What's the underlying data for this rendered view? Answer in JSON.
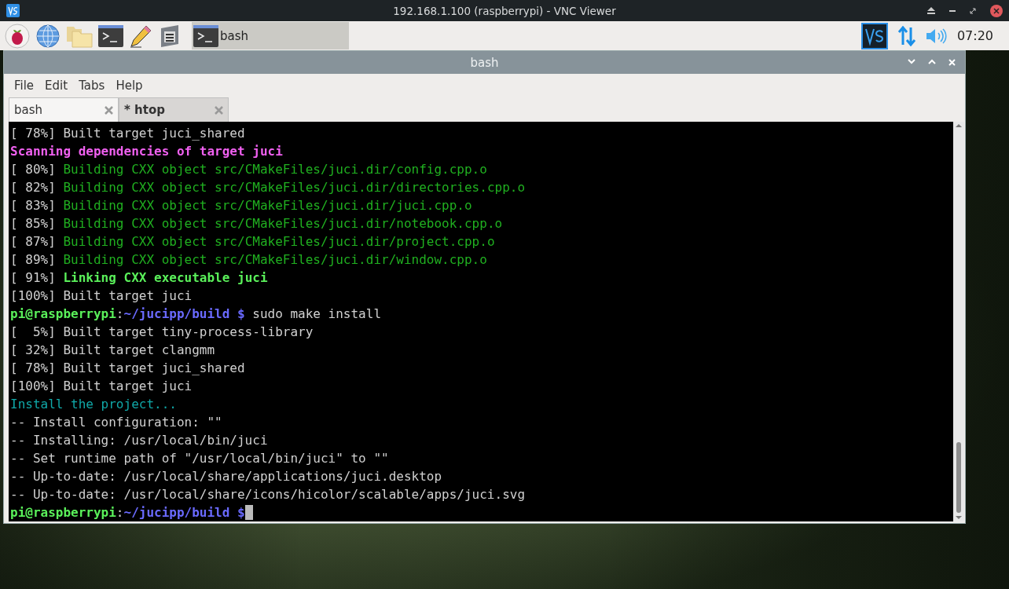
{
  "vnc_window": {
    "title": "192.168.1.100 (raspberrypi) - VNC Viewer"
  },
  "taskbar": {
    "task_button": {
      "label": "bash"
    },
    "clock": "07:20"
  },
  "terminal": {
    "title": "bash",
    "menu": [
      "File",
      "Edit",
      "Tabs",
      "Help"
    ],
    "tabs": [
      {
        "label": "bash",
        "selected": true,
        "activity": false
      },
      {
        "label": "* htop",
        "selected": false,
        "activity": true
      }
    ],
    "lines": [
      {
        "cursor": false,
        "segments": [
          {
            "text": "[ 78%] Built target juci_shared",
            "kind": "plain"
          }
        ]
      },
      {
        "cursor": false,
        "segments": [
          {
            "text": "Scanning dependencies of target juci",
            "kind": "scan"
          }
        ]
      },
      {
        "cursor": false,
        "segments": [
          {
            "text": "[ 80%] ",
            "kind": "plain"
          },
          {
            "text": "Building CXX object src/CMakeFiles/juci.dir/config.cpp.o",
            "kind": "build"
          }
        ]
      },
      {
        "cursor": false,
        "segments": [
          {
            "text": "[ 82%] ",
            "kind": "plain"
          },
          {
            "text": "Building CXX object src/CMakeFiles/juci.dir/directories.cpp.o",
            "kind": "build"
          }
        ]
      },
      {
        "cursor": false,
        "segments": [
          {
            "text": "[ 83%] ",
            "kind": "plain"
          },
          {
            "text": "Building CXX object src/CMakeFiles/juci.dir/juci.cpp.o",
            "kind": "build"
          }
        ]
      },
      {
        "cursor": false,
        "segments": [
          {
            "text": "[ 85%] ",
            "kind": "plain"
          },
          {
            "text": "Building CXX object src/CMakeFiles/juci.dir/notebook.cpp.o",
            "kind": "build"
          }
        ]
      },
      {
        "cursor": false,
        "segments": [
          {
            "text": "[ 87%] ",
            "kind": "plain"
          },
          {
            "text": "Building CXX object src/CMakeFiles/juci.dir/project.cpp.o",
            "kind": "build"
          }
        ]
      },
      {
        "cursor": false,
        "segments": [
          {
            "text": "[ 89%] ",
            "kind": "plain"
          },
          {
            "text": "Building CXX object src/CMakeFiles/juci.dir/window.cpp.o",
            "kind": "build"
          }
        ]
      },
      {
        "cursor": false,
        "segments": [
          {
            "text": "[ 91%] ",
            "kind": "plain"
          },
          {
            "text": "Linking CXX executable juci",
            "kind": "link"
          }
        ]
      },
      {
        "cursor": false,
        "segments": [
          {
            "text": "[100%] Built target juci",
            "kind": "plain"
          }
        ]
      },
      {
        "cursor": false,
        "segments": [
          {
            "text": "pi@raspberrypi",
            "kind": "user"
          },
          {
            "text": ":",
            "kind": "plain"
          },
          {
            "text": "~/jucipp/build $",
            "kind": "path"
          },
          {
            "text": " sudo make install",
            "kind": "plain"
          }
        ]
      },
      {
        "cursor": false,
        "segments": [
          {
            "text": "[  5%] Built target tiny-process-library",
            "kind": "plain"
          }
        ]
      },
      {
        "cursor": false,
        "segments": [
          {
            "text": "[ 32%] Built target clangmm",
            "kind": "plain"
          }
        ]
      },
      {
        "cursor": false,
        "segments": [
          {
            "text": "[ 78%] Built target juci_shared",
            "kind": "plain"
          }
        ]
      },
      {
        "cursor": false,
        "segments": [
          {
            "text": "[100%] Built target juci",
            "kind": "plain"
          }
        ]
      },
      {
        "cursor": false,
        "segments": [
          {
            "text": "Install the project...",
            "kind": "install"
          }
        ]
      },
      {
        "cursor": false,
        "segments": [
          {
            "text": "-- Install configuration: \"\"",
            "kind": "plain"
          }
        ]
      },
      {
        "cursor": false,
        "segments": [
          {
            "text": "-- Installing: /usr/local/bin/juci",
            "kind": "plain"
          }
        ]
      },
      {
        "cursor": false,
        "segments": [
          {
            "text": "-- Set runtime path of \"/usr/local/bin/juci\" to \"\"",
            "kind": "plain"
          }
        ]
      },
      {
        "cursor": false,
        "segments": [
          {
            "text": "-- Up-to-date: /usr/local/share/applications/juci.desktop",
            "kind": "plain"
          }
        ]
      },
      {
        "cursor": false,
        "segments": [
          {
            "text": "-- Up-to-date: /usr/local/share/icons/hicolor/scalable/apps/juci.svg",
            "kind": "plain"
          }
        ]
      },
      {
        "cursor": true,
        "segments": [
          {
            "text": "pi@raspberrypi",
            "kind": "user"
          },
          {
            "text": ":",
            "kind": "plain"
          },
          {
            "text": "~/jucipp/build $",
            "kind": "path"
          }
        ]
      }
    ]
  }
}
